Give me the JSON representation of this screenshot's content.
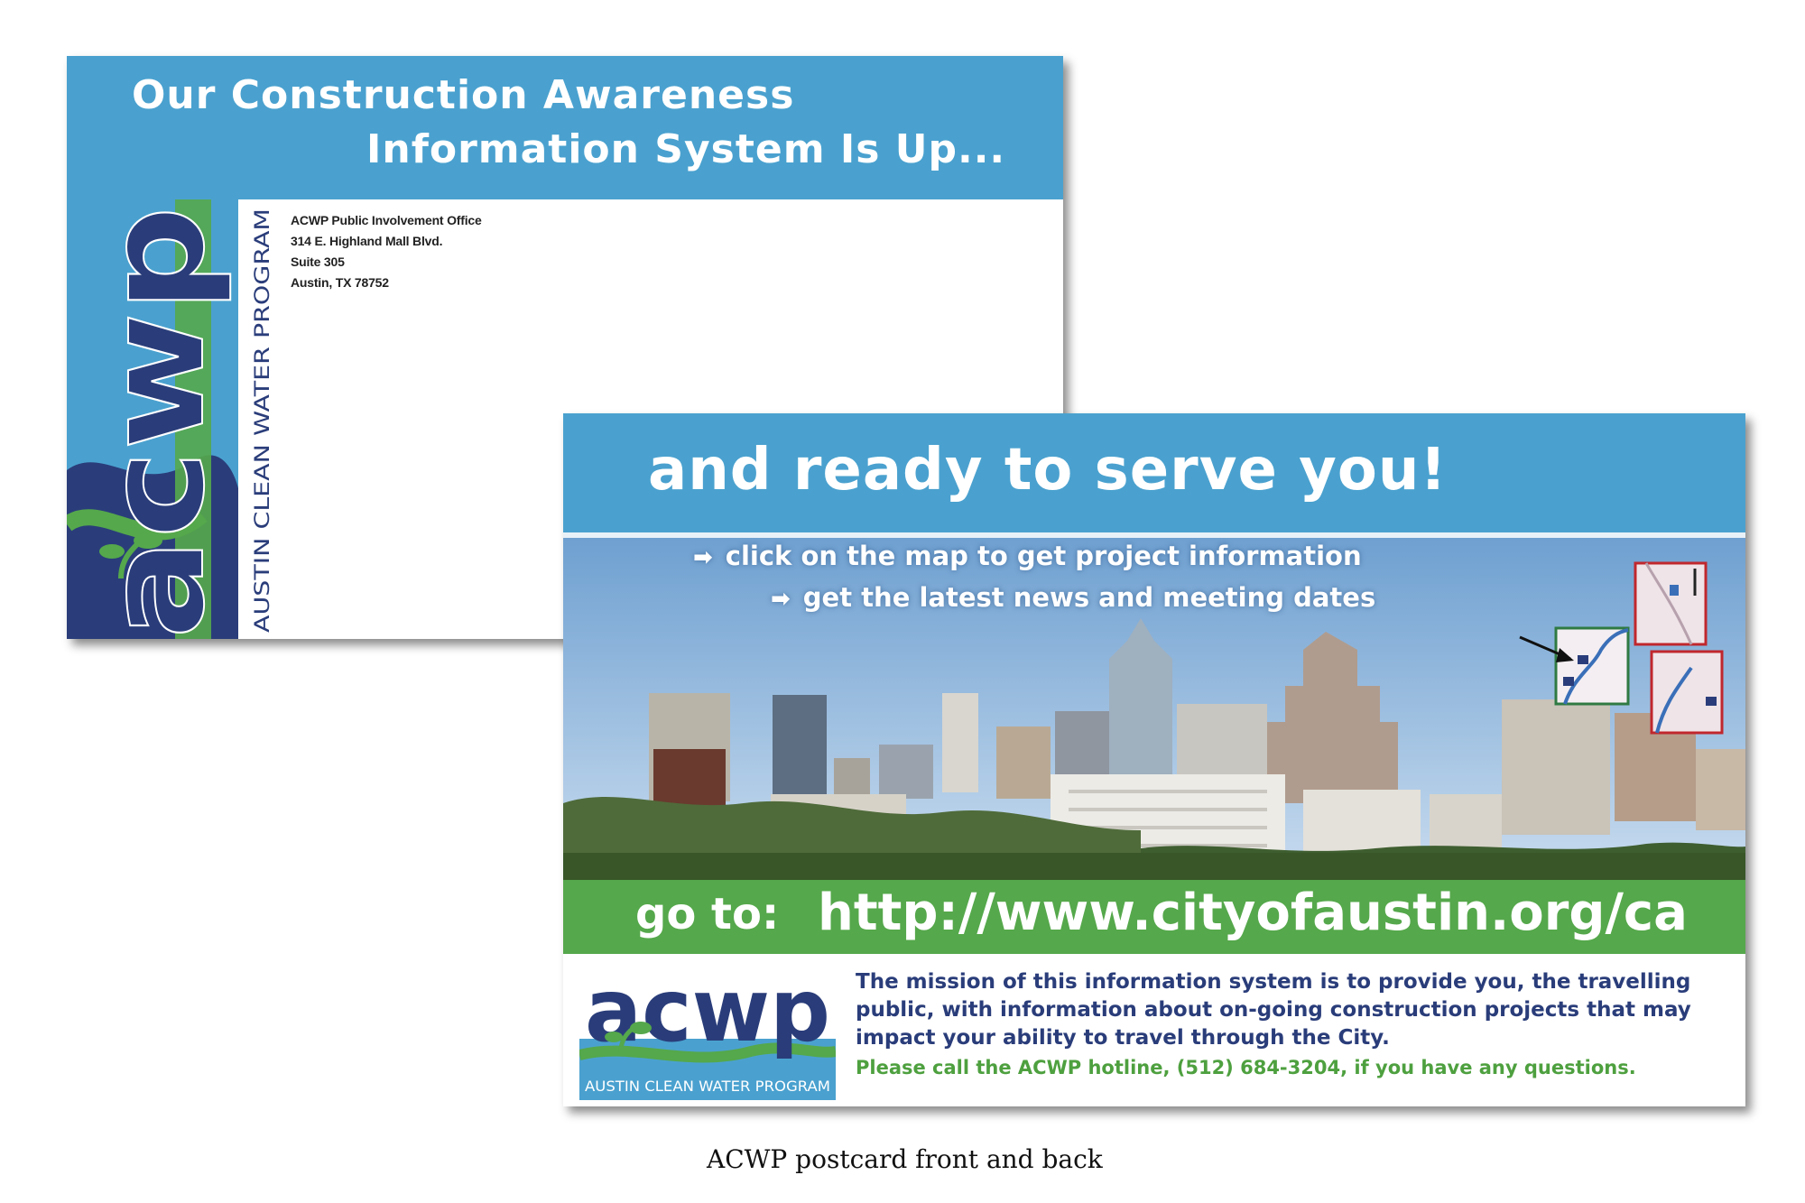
{
  "front": {
    "title_line1": "Our Construction Awareness",
    "title_line2": "Information System Is Up...",
    "logo_text": "acwp",
    "logo_tagline": "AUSTIN CLEAN WATER PROGRAM",
    "address": {
      "line1": "ACWP Public Involvement Office",
      "line2": "314 E. Highland Mall Blvd.",
      "line3": "Suite 305",
      "line4": "Austin, TX  78752"
    },
    "colors": {
      "banner_blue": "#4aa1cf",
      "navy": "#2a3d7a",
      "green": "#55a84b"
    }
  },
  "back": {
    "headline": "and ready to serve you!",
    "bullets": [
      "click on the map to get project information",
      "get the latest news and meeting dates"
    ],
    "goto_label": "go to:",
    "goto_url": "http://www.cityofaustin.org/ca",
    "logo_text": "acwp",
    "logo_tagline": "AUSTIN CLEAN WATER PROGRAM",
    "mission": "The mission of this information system is to provide you, the travelling public, with information about on-going construction projects that may impact your ability to travel through the City.",
    "hotline": "Please call the ACWP hotline, (512) 684-3204, if you have any questions.",
    "icons": [
      "arrow-right-icon",
      "map-thumbnail-icon",
      "pointer-arrow-icon"
    ]
  },
  "caption": "ACWP postcard front and back"
}
